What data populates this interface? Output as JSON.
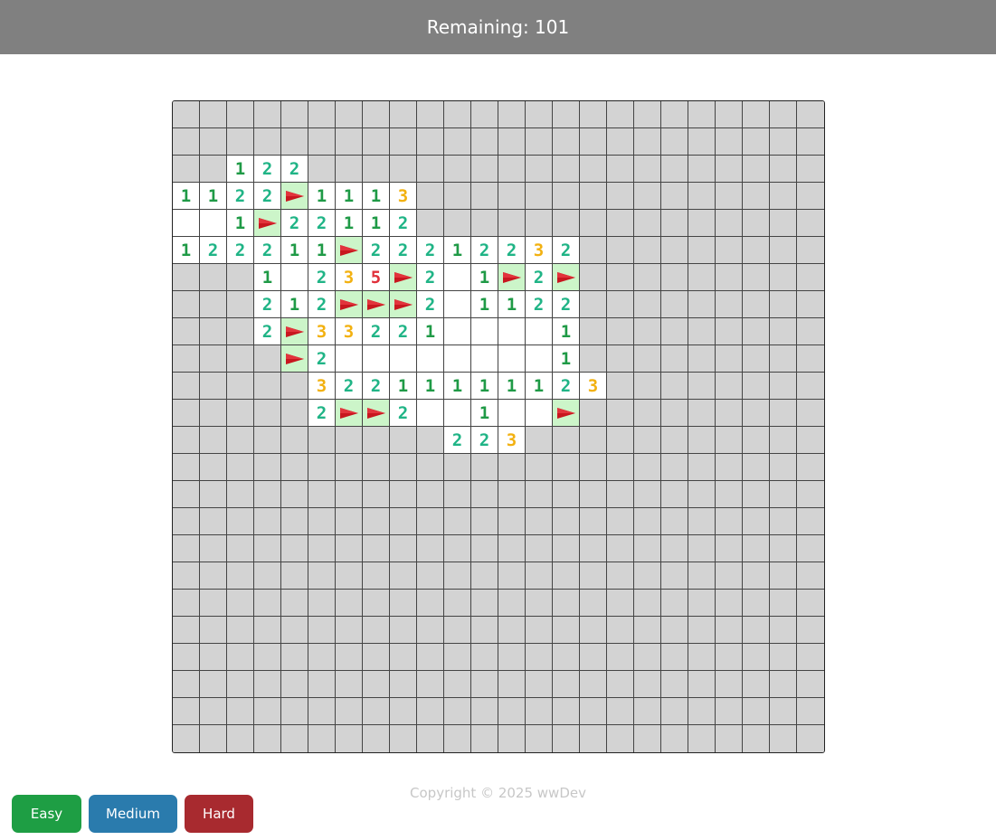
{
  "header": {
    "remaining_text": "Remaining: 101"
  },
  "board": {
    "cols": 24,
    "rows": 24,
    "legend": "H = covered, F = flag, . = open empty, digits = open number",
    "grid": [
      "HHHHHHHHHHHHHHHHHHHHHHHH",
      "HHHHHHHHHHHHHHHHHHHHHHHH",
      "HH122HHHHHHHHHHHHHHHHHHH",
      "1122F1113HHHHHHHHHHHHHHH",
      "..1F22112HHHHHHHHHHHHHHH",
      "122211F2221223 2HHHHHHHHH",
      "HHH1.235F2.1F2FHHHHHHHHH",
      "HHH212FFF2.1122HHHHHHHHH",
      "HHH2F33221....1HHHHHHHHH",
      "HHHHF2........1HHHHHHHHH",
      "HHHHH322111111 23HHHHHHHHH",
      "HHHHH2FF2..1..FHHHHHHHHH",
      "HHHHHHHHHH223HHHHHHHHHHH",
      "HHHHHHHHHHHHHHHHHHHHHHHH",
      "HHHHHHHHHHHHHHHHHHHHHHHH",
      "HHHHHHHHHHHHHHHHHHHHHHHH",
      "HHHHHHHHHHHHHHHHHHHHHHHH",
      "HHHHHHHHHHHHHHHHHHHHHHHH",
      "HHHHHHHHHHHHHHHHHHHHHHHH",
      "HHHHHHHHHHHHHHHHHHHHHHHH",
      "HHHHHHHHHHHHHHHHHHHHHHHH",
      "HHHHHHHHHHHHHHHHHHHHHHHH",
      "HHHHHHHHHHHHHHHHHHHHHHHH",
      "HHHHHHHHHHHHHHHHHHHHHHHH"
    ],
    "number_colors": {
      "1": "#1f9a46",
      "2": "#20b486",
      "3": "#f2b111",
      "5": "#e0303a"
    },
    "flag_color": "#c8171f",
    "flag_bg": "#ccf5c9",
    "covered_color": "#d3d3d3"
  },
  "footer": {
    "copyright": "Copyright © 2025 wwDev"
  },
  "difficulty": {
    "easy_label": "Easy",
    "medium_label": "Medium",
    "hard_label": "Hard",
    "easy_color": "#1e9e44",
    "medium_color": "#2a7bad",
    "hard_color": "#a82a2f"
  }
}
